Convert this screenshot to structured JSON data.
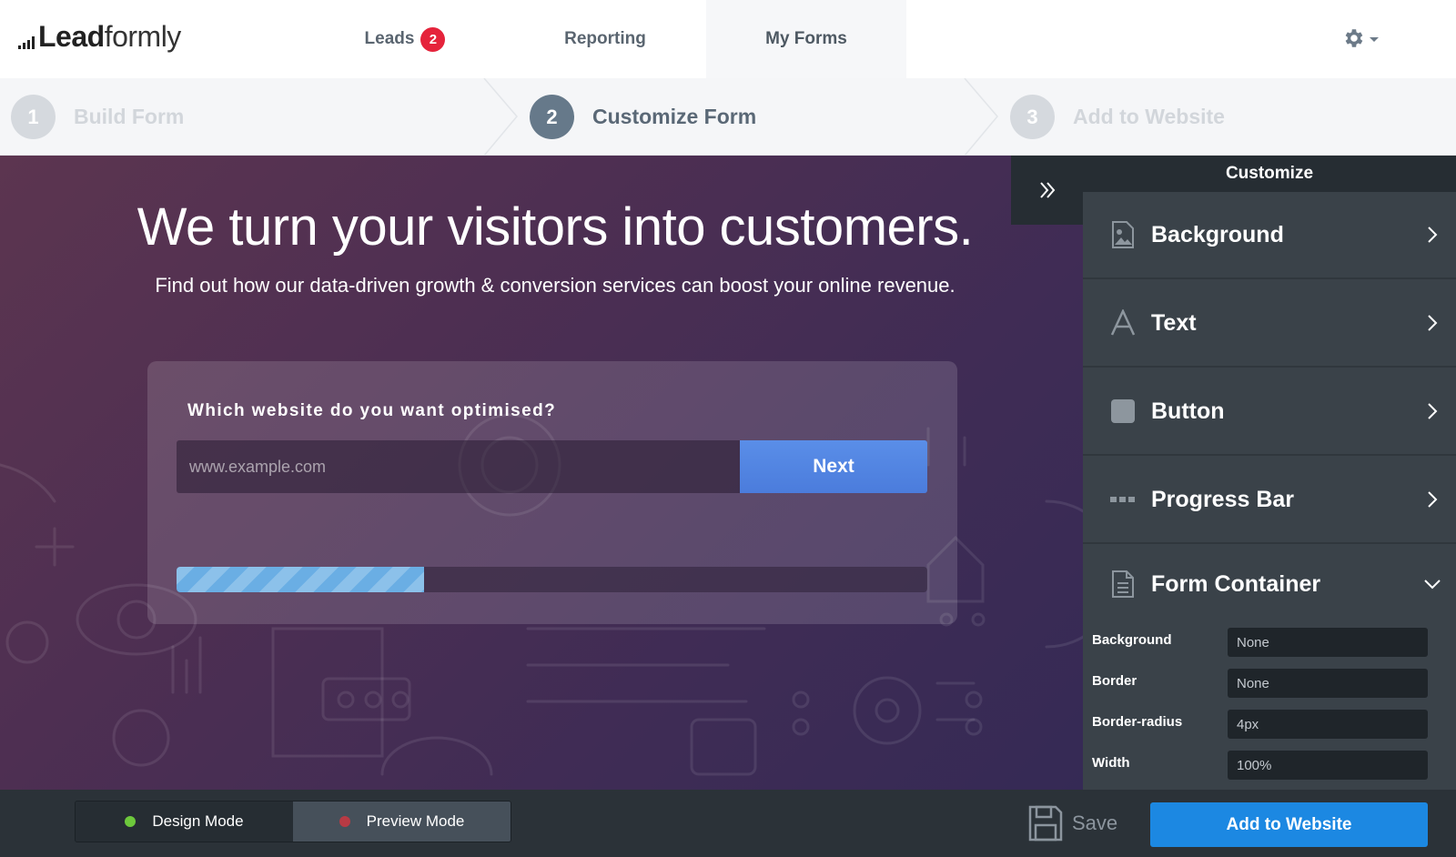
{
  "brand": {
    "logo_bold": "Lead",
    "logo_light": "formly"
  },
  "nav": {
    "leads_label": "Leads",
    "leads_count": "2",
    "reporting_label": "Reporting",
    "myforms_label": "My Forms",
    "settings_icon": "gear-icon"
  },
  "steps": [
    {
      "num": "1",
      "label": "Build Form",
      "active": false
    },
    {
      "num": "2",
      "label": "Customize Form",
      "active": true
    },
    {
      "num": "3",
      "label": "Add to Website",
      "active": false
    }
  ],
  "preview": {
    "title": "We turn your visitors into customers.",
    "subtitle": "Find out how our data-driven growth & conversion services can boost your online revenue.",
    "question": "Which website do you want optimised?",
    "input_placeholder": "www.example.com",
    "next_label": "Next",
    "progress": 0.33
  },
  "panel": {
    "title": "Customize",
    "sections": [
      {
        "label": "Background",
        "icon": "image-icon",
        "expanded": false
      },
      {
        "label": "Text",
        "icon": "font-icon",
        "expanded": false
      },
      {
        "label": "Button",
        "icon": "button-icon",
        "expanded": false
      },
      {
        "label": "Progress Bar",
        "icon": "progress-dots-icon",
        "expanded": false
      },
      {
        "label": "Form Container",
        "icon": "document-icon",
        "expanded": true
      }
    ],
    "form_container_props": [
      {
        "label": "Background",
        "value": "None"
      },
      {
        "label": "Border",
        "value": "None"
      },
      {
        "label": "Border-radius",
        "value": "4px"
      },
      {
        "label": "Width",
        "value": "100%"
      }
    ]
  },
  "bottom": {
    "design_mode": "Design Mode",
    "preview_mode": "Preview Mode",
    "save_label": "Save",
    "add_label": "Add to Website"
  },
  "colors": {
    "accent_blue": "#1c88e2",
    "badge_red": "#e5233b",
    "design_dot": "#6dc83c",
    "preview_dot": "#b83a44"
  }
}
